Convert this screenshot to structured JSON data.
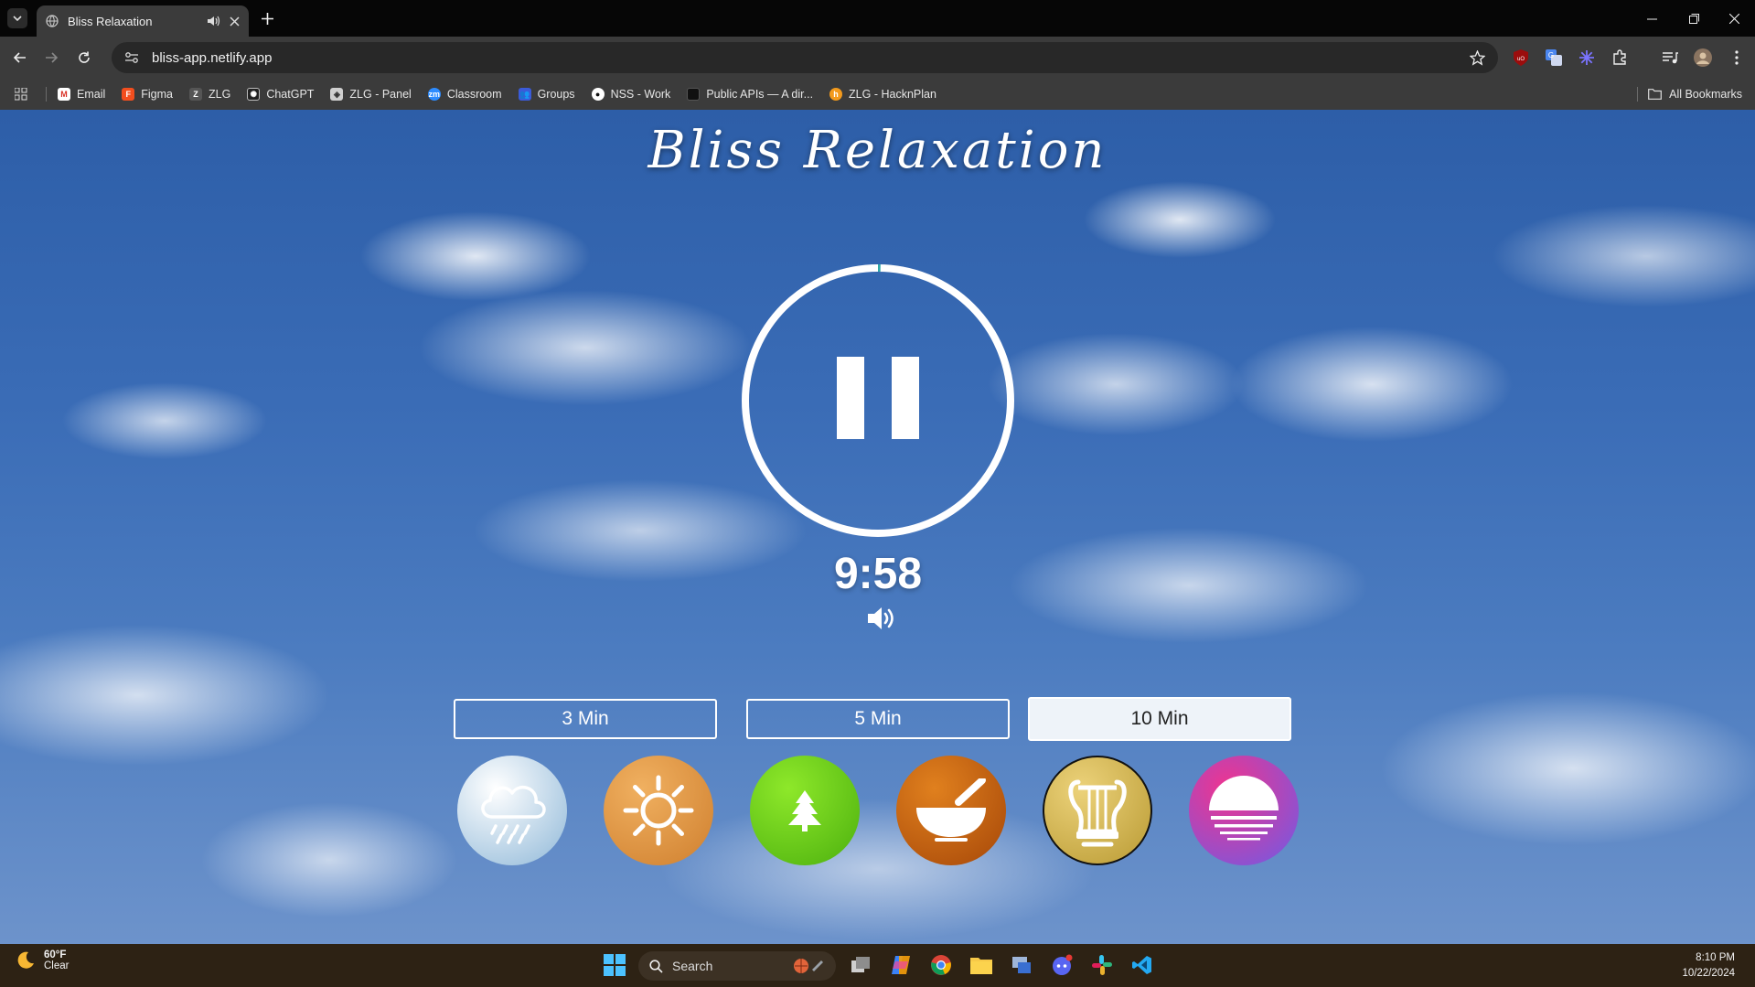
{
  "browser": {
    "tab_title": "Bliss Relaxation",
    "url": "bliss-app.netlify.app",
    "bookmarks": [
      {
        "label": "Email",
        "icon": "gmail-icon"
      },
      {
        "label": "Figma",
        "icon": "figma-icon"
      },
      {
        "label": "ZLG",
        "icon": "zlg-icon"
      },
      {
        "label": "ChatGPT",
        "icon": "chatgpt-icon"
      },
      {
        "label": "ZLG - Panel",
        "icon": "zlg-panel-icon"
      },
      {
        "label": "Classroom",
        "icon": "zoom-icon"
      },
      {
        "label": "Groups",
        "icon": "groups-icon"
      },
      {
        "label": "NSS - Work",
        "icon": "github-icon"
      },
      {
        "label": "Public APIs — A dir...",
        "icon": "public-apis-icon"
      },
      {
        "label": "ZLG - HacknPlan",
        "icon": "hacknplan-icon"
      }
    ],
    "all_bookmarks_label": "All Bookmarks"
  },
  "app": {
    "title": "Bliss Relaxation",
    "timer": "9:58",
    "progress_fraction": 0.003,
    "durations": [
      {
        "label": "3 Min",
        "active": false
      },
      {
        "label": "5 Min",
        "active": false
      },
      {
        "label": "10 Min",
        "active": true
      }
    ],
    "sounds": [
      {
        "name": "rain",
        "icon": "rain-cloud-icon",
        "color_from": "#ffffff",
        "color_to": "#8fb8d8"
      },
      {
        "name": "sun",
        "icon": "sun-icon",
        "color_from": "#f0b060",
        "color_to": "#cf7f2e"
      },
      {
        "name": "forest",
        "icon": "tree-icon",
        "color_from": "#8ee82a",
        "color_to": "#4cb00e"
      },
      {
        "name": "singing-bowl",
        "icon": "singing-bowl-icon",
        "color_from": "#e0801e",
        "color_to": "#a64708"
      },
      {
        "name": "lyre",
        "icon": "lyre-icon",
        "color_from": "#ecd27a",
        "color_to": "#b99a33",
        "selected": true
      },
      {
        "name": "sunset",
        "icon": "sunset-icon",
        "color_from": "#f0348f",
        "color_to": "#6d5be6"
      }
    ]
  },
  "taskbar": {
    "weather_temp": "60°F",
    "weather_desc": "Clear",
    "search_label": "Search",
    "time": "8:10 PM",
    "date": "10/22/2024"
  }
}
